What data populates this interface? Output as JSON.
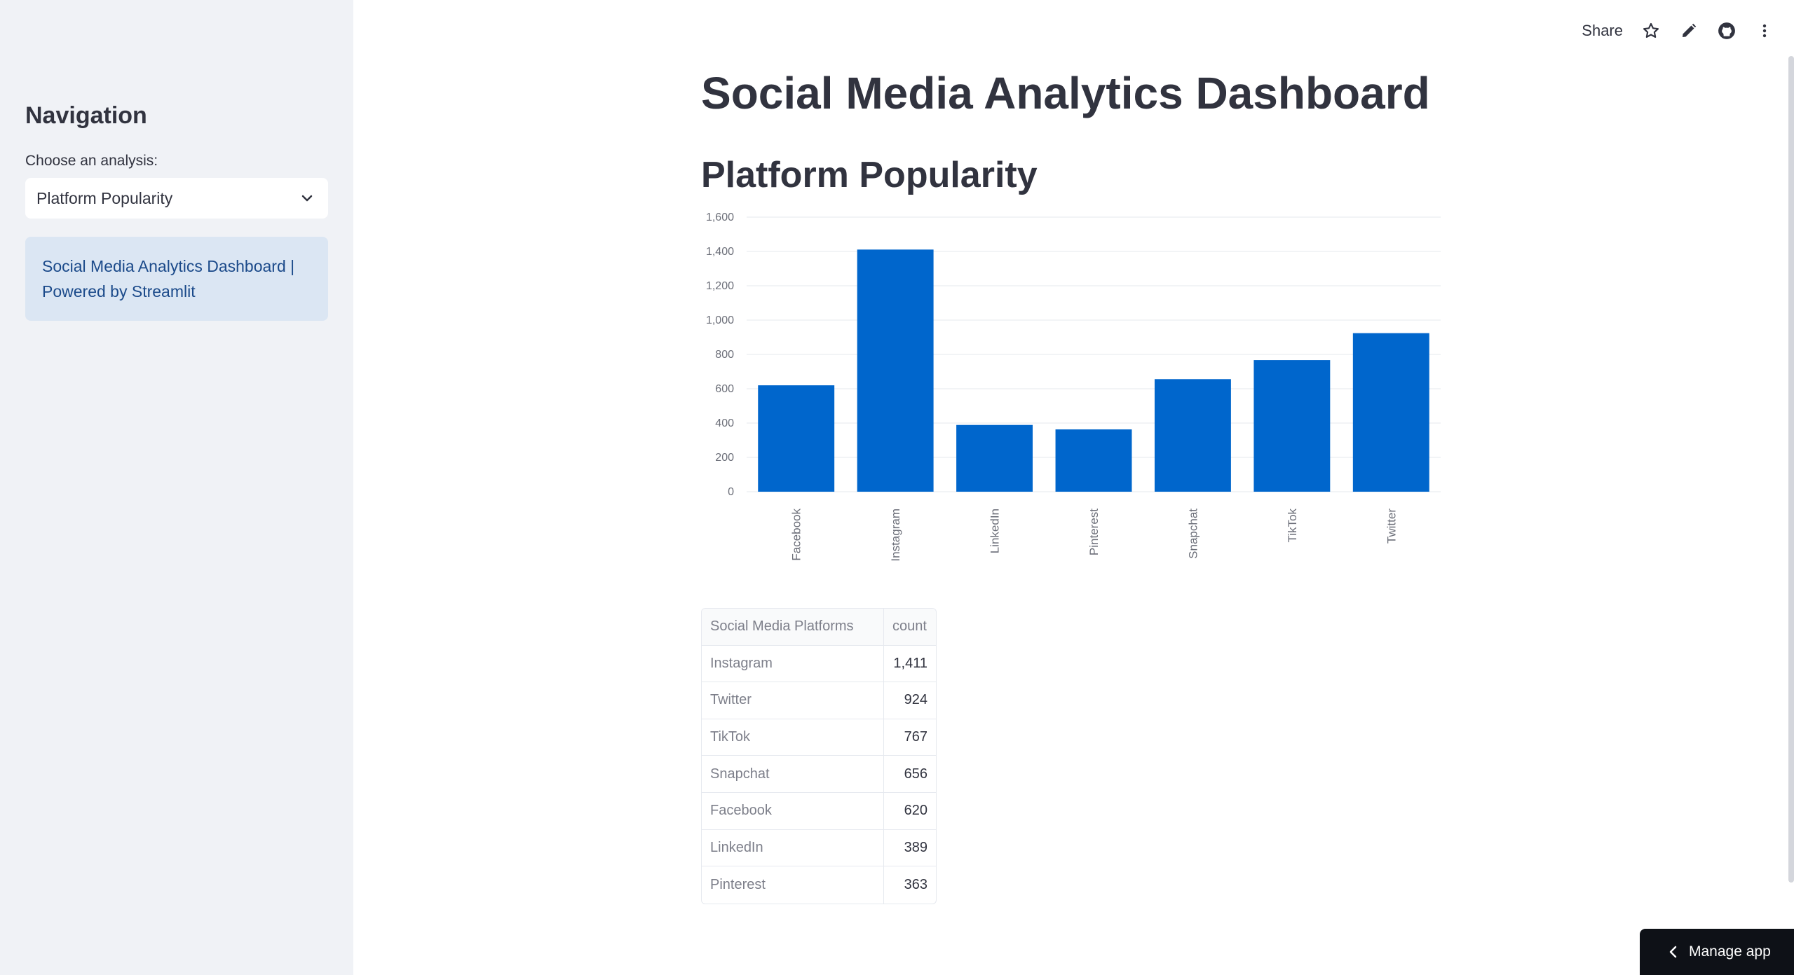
{
  "sidebar": {
    "heading": "Navigation",
    "select_label": "Choose an analysis:",
    "select_value": "Platform Popularity",
    "info_line1": "Social Media Analytics Dashboard |",
    "info_line2": "Powered by Streamlit"
  },
  "toolbar": {
    "share_label": "Share",
    "icons": [
      "star-icon",
      "pencil-icon",
      "github-icon",
      "kebab-menu-icon"
    ]
  },
  "main": {
    "title": "Social Media Analytics Dashboard",
    "subtitle": "Platform Popularity"
  },
  "chart_data": {
    "type": "bar",
    "categories": [
      "Facebook",
      "Instagram",
      "LinkedIn",
      "Pinterest",
      "Snapchat",
      "TikTok",
      "Twitter"
    ],
    "values": [
      620,
      1411,
      389,
      363,
      656,
      767,
      924
    ],
    "ylim": [
      0,
      1600
    ],
    "yticks": [
      0,
      200,
      400,
      600,
      800,
      1000,
      1200,
      1400,
      1600
    ],
    "ytick_labels": [
      "0",
      "200",
      "400",
      "600",
      "800",
      "1,000",
      "1,200",
      "1,400",
      "1,600"
    ],
    "color": "#0066cc",
    "grid": true
  },
  "table": {
    "headers": [
      "Social Media Platforms",
      "count"
    ],
    "rows": [
      [
        "Instagram",
        "1,411"
      ],
      [
        "Twitter",
        "924"
      ],
      [
        "TikTok",
        "767"
      ],
      [
        "Snapchat",
        "656"
      ],
      [
        "Facebook",
        "620"
      ],
      [
        "LinkedIn",
        "389"
      ],
      [
        "Pinterest",
        "363"
      ]
    ]
  },
  "footer": {
    "manage_label": "Manage app"
  },
  "colors": {
    "sidebar_bg": "#f0f2f6",
    "info_bg": "#dbe6f3",
    "info_text": "#1b4a8a",
    "bar": "#0066cc"
  }
}
